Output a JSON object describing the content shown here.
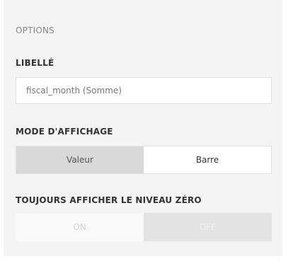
{
  "panel": {
    "title": "OPTIONS"
  },
  "libelle": {
    "label": "LIBELLÉ",
    "value": "fiscal_month (Somme)"
  },
  "display_mode": {
    "label": "MODE D'AFFICHAGE",
    "options": [
      "Valeur",
      "Barre"
    ],
    "selected": "Valeur"
  },
  "zero_level": {
    "label": "TOUJOURS AFFICHER LE NIVEAU ZÉRO",
    "on_label": "ON",
    "off_label": "OFF",
    "state": "disabled"
  }
}
